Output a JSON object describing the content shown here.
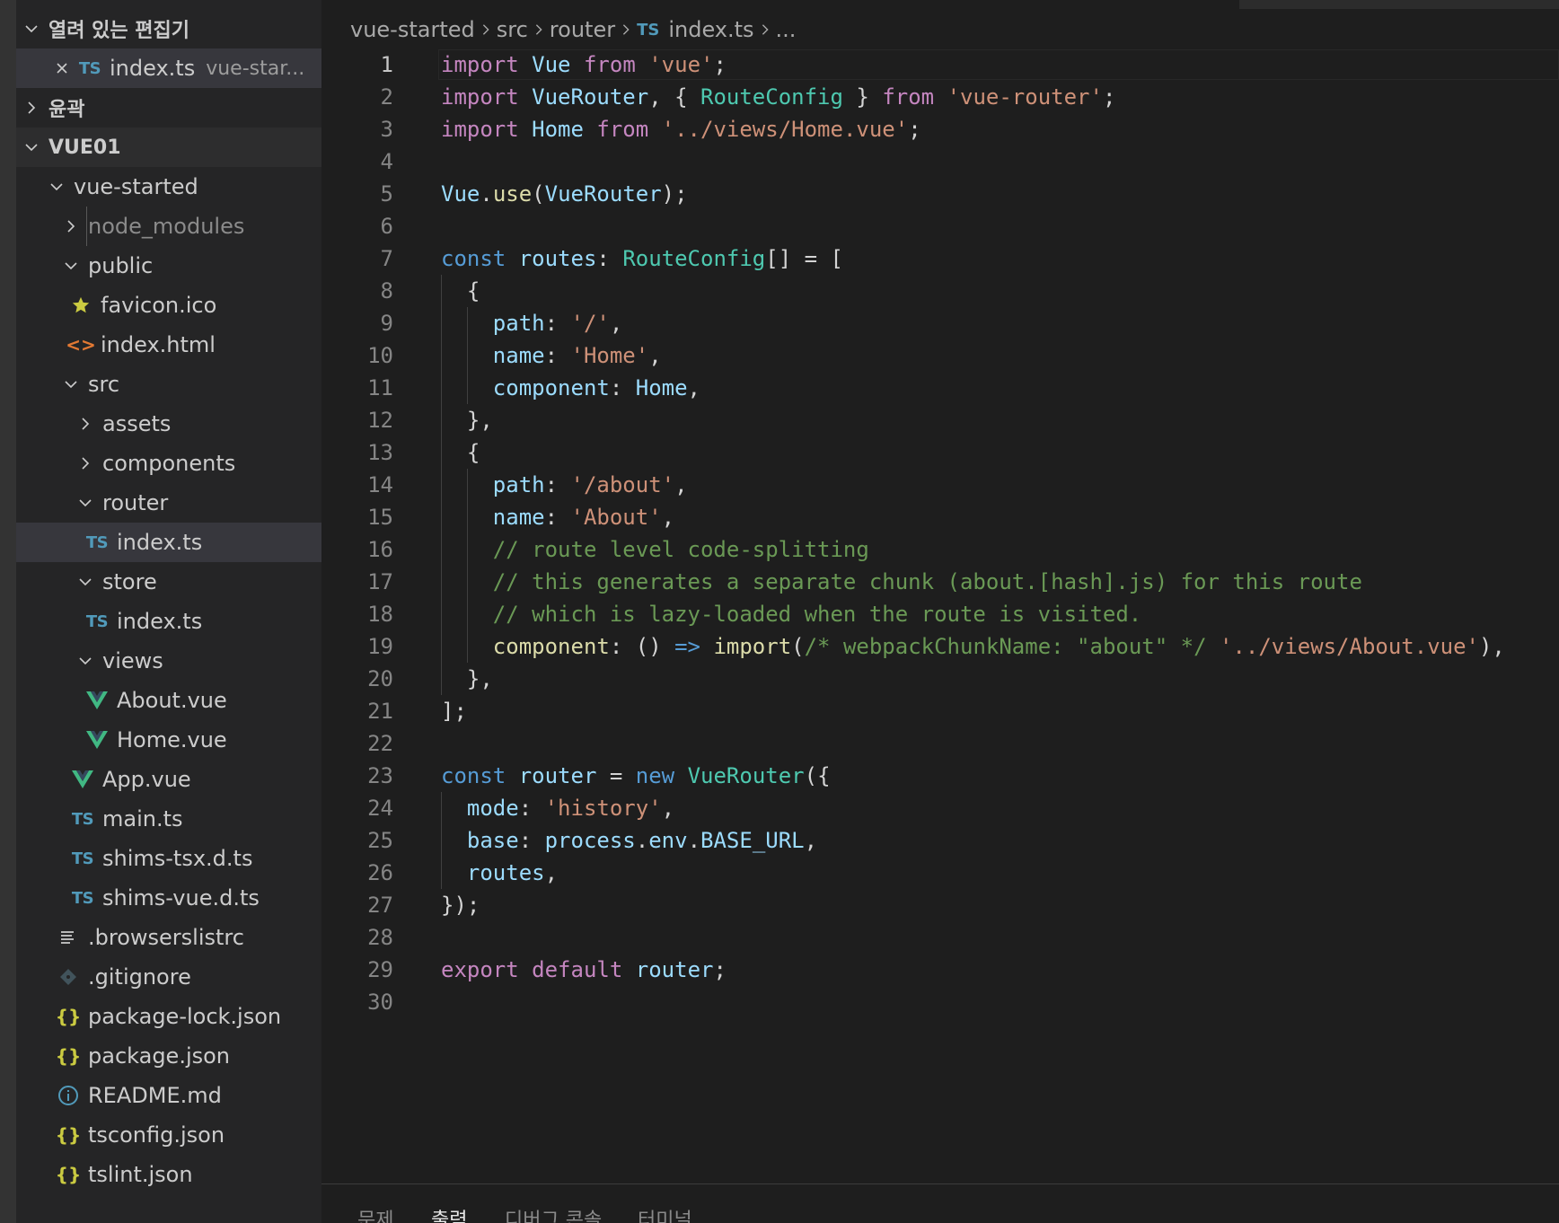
{
  "sidebar": {
    "open_editors": {
      "title": "열려 있는 편집기",
      "items": [
        {
          "name": "index.ts",
          "description": "vue-star..."
        }
      ]
    },
    "outline": {
      "title": "윤곽"
    },
    "workspace": {
      "title": "VUE01"
    },
    "tree": [
      {
        "label": "vue-started"
      },
      {
        "label": "node_modules"
      },
      {
        "label": "public"
      },
      {
        "label": "favicon.ico"
      },
      {
        "label": "index.html"
      },
      {
        "label": "src"
      },
      {
        "label": "assets"
      },
      {
        "label": "components"
      },
      {
        "label": "router"
      },
      {
        "label": "index.ts"
      },
      {
        "label": "store"
      },
      {
        "label": "index.ts"
      },
      {
        "label": "views"
      },
      {
        "label": "About.vue"
      },
      {
        "label": "Home.vue"
      },
      {
        "label": "App.vue"
      },
      {
        "label": "main.ts"
      },
      {
        "label": "shims-tsx.d.ts"
      },
      {
        "label": "shims-vue.d.ts"
      },
      {
        "label": ".browserslistrc"
      },
      {
        "label": ".gitignore"
      },
      {
        "label": "package-lock.json"
      },
      {
        "label": "package.json"
      },
      {
        "label": "README.md"
      },
      {
        "label": "tsconfig.json"
      },
      {
        "label": "tslint.json"
      }
    ],
    "icons": {
      "ts": "TS",
      "json": "{}",
      "html": "<>"
    }
  },
  "breadcrumb": {
    "items": [
      "vue-started",
      "src",
      "router",
      "index.ts",
      "..."
    ]
  },
  "editor": {
    "active_line": 1,
    "line_numbers": [
      "1",
      "2",
      "3",
      "4",
      "5",
      "6",
      "7",
      "8",
      "9",
      "10",
      "11",
      "12",
      "13",
      "14",
      "15",
      "16",
      "17",
      "18",
      "19",
      "20",
      "21",
      "22",
      "23",
      "24",
      "25",
      "26",
      "27",
      "28",
      "29",
      "30"
    ],
    "lines": [
      "import Vue from 'vue';",
      "import VueRouter, { RouteConfig } from 'vue-router';",
      "import Home from '../views/Home.vue';",
      "",
      "Vue.use(VueRouter);",
      "",
      "const routes: RouteConfig[] = [",
      "  {",
      "    path: '/',",
      "    name: 'Home',",
      "    component: Home,",
      "  },",
      "  {",
      "    path: '/about',",
      "    name: 'About',",
      "    // route level code-splitting",
      "    // this generates a separate chunk (about.[hash].js) for this route",
      "    // which is lazy-loaded when the route is visited.",
      "    component: () => import(/* webpackChunkName: \"about\" */ '../views/About.vue'),",
      "  },",
      "];",
      "",
      "const router = new VueRouter({",
      "  mode: 'history',",
      "  base: process.env.BASE_URL,",
      "  routes,",
      "});",
      "",
      "export default router;",
      ""
    ]
  },
  "panel": {
    "tabs": [
      "문제",
      "출력",
      "디버그 콘솔",
      "터미널"
    ],
    "active_tab": "출력"
  },
  "colors": {
    "sidebar_bg": "#252526",
    "editor_bg": "#1e1e1e",
    "selection_bg": "#37373d",
    "ts_icon": "#519aba",
    "json_icon": "#cbcb41",
    "vue_icon": "#41b883",
    "keyword": "#c586c0",
    "string": "#ce9178",
    "comment": "#6a9955"
  }
}
